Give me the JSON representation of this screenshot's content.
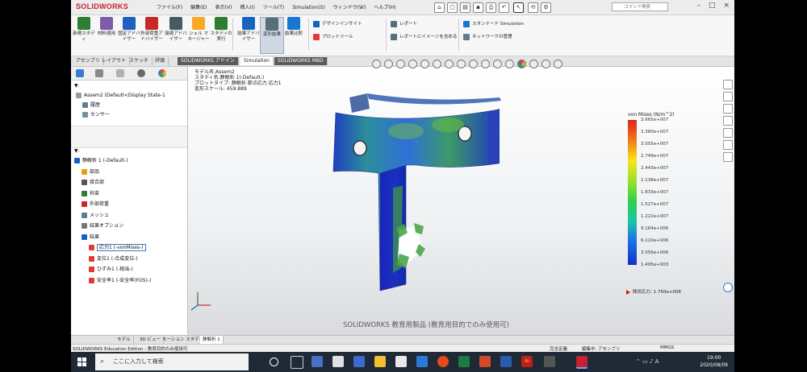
{
  "app": {
    "logo": "SOLIDWORKS",
    "menu": [
      "ファイル(F)",
      "編集(E)",
      "表示(V)",
      "挿入(I)",
      "ツール(T)",
      "Simulation(S)",
      "ウィンドウ(W)",
      "ヘルプ(H)"
    ],
    "search_placeholder": "コマンド検索"
  },
  "ribbon": {
    "buttons": [
      {
        "label": "新規スタディ",
        "color": "#2e7d32"
      },
      {
        "label": "材料適用",
        "color": "#7b5ea7"
      },
      {
        "label": "固定アドバイザー",
        "color": "#1f5fbf"
      },
      {
        "label": "外部荷重アドバイザー",
        "color": "#c62828"
      },
      {
        "label": "接続アドバイザー",
        "color": "#455a64"
      },
      {
        "label": "シェル マネージャー",
        "color": "#f9a825"
      },
      {
        "label": "スタディの実行",
        "color": "#2e7d32"
      },
      {
        "label": "結果アドバイザー",
        "color": "#1565c0"
      },
      {
        "label": "変形結果",
        "color": "#546e7a"
      },
      {
        "label": "結果比較",
        "color": "#1976d2"
      }
    ],
    "small": [
      "デザインインサイト",
      "プロットツール",
      "レポート",
      "レポートにイメージを含める",
      "スタンドード Simulation",
      "ネットワークの管理"
    ]
  },
  "tabs": [
    "アセンブリ",
    "レイアウト",
    "スケッチ",
    "評価",
    "SOLIDWORKS アドイン",
    "Simulation",
    "SOLIDWORKS MBD"
  ],
  "left_panel": {
    "top_tree": [
      "Assem2 (Default<Display State-1",
      "履歴",
      "センサー"
    ],
    "study_tree": [
      {
        "label": "静解析 1 (-Default-)",
        "indent": 0,
        "color": "#1565c0"
      },
      {
        "label": "部品",
        "indent": 1,
        "color": "#e0a020"
      },
      {
        "label": "接合部",
        "indent": 1,
        "color": "#555"
      },
      {
        "label": "拘束",
        "indent": 1,
        "color": "#2e7d32"
      },
      {
        "label": "外部荷重",
        "indent": 1,
        "color": "#c62828"
      },
      {
        "label": "メッシュ",
        "indent": 1,
        "color": "#607d8b"
      },
      {
        "label": "結果オプション",
        "indent": 1,
        "color": "#777"
      },
      {
        "label": "結果",
        "indent": 1,
        "color": "#1565c0"
      },
      {
        "label": "応力1 (-vonMises-)",
        "indent": 2,
        "color": "#e53935",
        "selected": true
      },
      {
        "label": "変位1 (-合成変位-)",
        "indent": 2,
        "color": "#e53935"
      },
      {
        "label": "ひずみ1 (-相当-)",
        "indent": 2,
        "color": "#e53935"
      },
      {
        "label": "安全率1 (-安全率(FOS)-)",
        "indent": 2,
        "color": "#e53935"
      }
    ]
  },
  "viewport": {
    "info": [
      "モデル名:Assem2",
      "スタディ名:静解析 1(-Default-)",
      "プロットタイプ: 静解析 節点応力 応力1",
      "変形スケール: 459.889"
    ],
    "legend": {
      "title": "von Mises (N/m^2)",
      "values": [
        "3.665e+007",
        "3.360e+007",
        "3.055e+007",
        "2.749e+007",
        "2.443e+007",
        "2.138e+007",
        "1.833e+007",
        "1.527e+007",
        "1.222e+007",
        "9.164e+006",
        "6.110e+006",
        "3.056e+006",
        "1.495e+003"
      ],
      "yield": "降伏応力: 1.750e+008"
    },
    "watermark": "SOLIDWORKS 教育用製品 (教育用目的でのみ使用可)"
  },
  "bottom_tabs": [
    "モデル",
    "3D ビュー",
    "モーション スタディ 1",
    "静解析 1"
  ],
  "status": {
    "left": "SOLIDWORKS Education Edition - 教育目的のみ使用可",
    "s1": "完全定義",
    "s2": "編集中: アセンブリ",
    "s3": "MMGS"
  },
  "taskbar": {
    "search": "ここに入力して検索",
    "time": "19:00",
    "date": "2020/08/09"
  }
}
